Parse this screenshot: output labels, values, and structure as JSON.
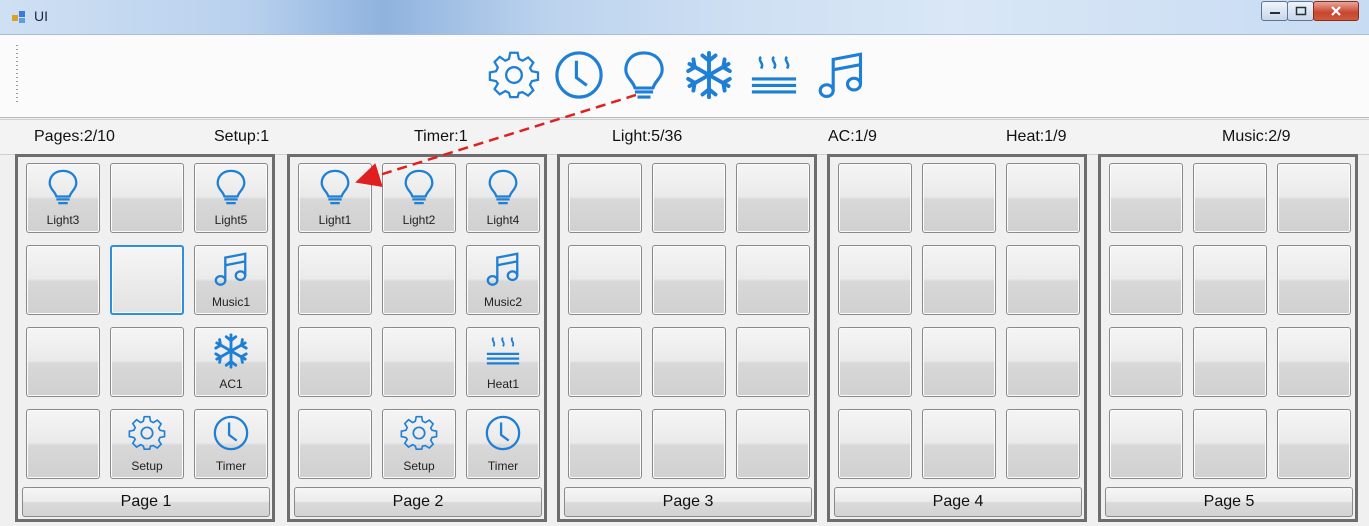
{
  "window": {
    "title": "UI"
  },
  "toolbar": {
    "icons": [
      "gear-icon",
      "clock-icon",
      "lightbulb-icon",
      "snowflake-icon",
      "heat-icon",
      "music-icon"
    ],
    "accent_color": "#1e7fd4"
  },
  "status": {
    "pages": "Pages:2/10",
    "setup": "Setup:1",
    "timer": "Timer:1",
    "light": "Light:5/36",
    "ac": "AC:1/9",
    "heat": "Heat:1/9",
    "music": "Music:2/9"
  },
  "pages": [
    {
      "label": "Page 1",
      "cells": [
        {
          "icon": "lightbulb-icon",
          "label": "Light3"
        },
        {
          "icon": "",
          "label": ""
        },
        {
          "icon": "lightbulb-icon",
          "label": "Light5"
        },
        {
          "icon": "",
          "label": ""
        },
        {
          "icon": "",
          "label": "",
          "selected": true
        },
        {
          "icon": "music-icon",
          "label": "Music1"
        },
        {
          "icon": "",
          "label": ""
        },
        {
          "icon": "",
          "label": ""
        },
        {
          "icon": "snowflake-icon",
          "label": "AC1"
        },
        {
          "icon": "",
          "label": ""
        },
        {
          "icon": "gear-icon",
          "label": "Setup"
        },
        {
          "icon": "clock-icon",
          "label": "Timer"
        }
      ]
    },
    {
      "label": "Page 2",
      "cells": [
        {
          "icon": "lightbulb-icon",
          "label": "Light1"
        },
        {
          "icon": "lightbulb-icon",
          "label": "Light2"
        },
        {
          "icon": "lightbulb-icon",
          "label": "Light4"
        },
        {
          "icon": "",
          "label": ""
        },
        {
          "icon": "",
          "label": ""
        },
        {
          "icon": "music-icon",
          "label": "Music2"
        },
        {
          "icon": "",
          "label": ""
        },
        {
          "icon": "",
          "label": ""
        },
        {
          "icon": "heat-icon",
          "label": "Heat1"
        },
        {
          "icon": "",
          "label": ""
        },
        {
          "icon": "gear-icon",
          "label": "Setup"
        },
        {
          "icon": "clock-icon",
          "label": "Timer"
        }
      ]
    },
    {
      "label": "Page 3",
      "cells": [
        {},
        {},
        {},
        {},
        {},
        {},
        {},
        {},
        {},
        {},
        {},
        {}
      ]
    },
    {
      "label": "Page 4",
      "cells": [
        {},
        {},
        {},
        {},
        {},
        {},
        {},
        {},
        {},
        {},
        {},
        {}
      ]
    },
    {
      "label": "Page 5",
      "cells": [
        {},
        {},
        {},
        {},
        {},
        {},
        {},
        {},
        {},
        {},
        {},
        {}
      ]
    }
  ]
}
